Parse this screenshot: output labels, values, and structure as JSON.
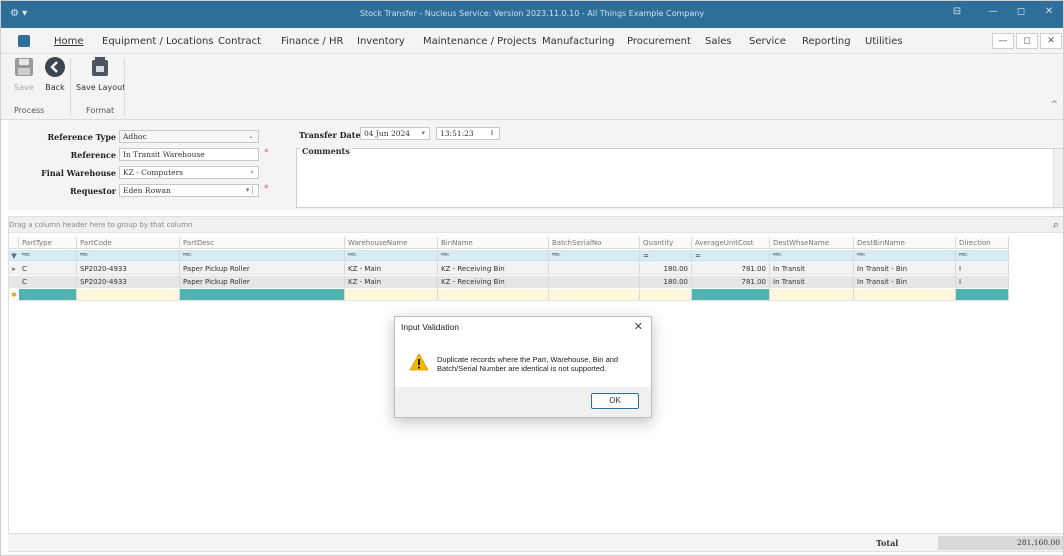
{
  "window": {
    "title": "Stock Transfer - Nucleus Service: Version 2023.11.0.10 - All Things Example Company",
    "left_glyph": "⚙ ▾",
    "controls": [
      "⊟",
      "—",
      "◻",
      "✕"
    ]
  },
  "menu": {
    "items": [
      "Home",
      "Equipment / Locations",
      "Contract",
      "Finance / HR",
      "Inventory",
      "Maintenance / Projects",
      "Manufacturing",
      "Procurement",
      "Sales",
      "Service",
      "Reporting",
      "Utilities"
    ],
    "window_controls": [
      "—",
      "◻",
      "✕"
    ]
  },
  "ribbon": {
    "save_label": "Save",
    "back_label": "Back",
    "save_layout_label": "Save Layout",
    "group_process": "Process",
    "group_format": "Format",
    "collapse_glyph": "^"
  },
  "form": {
    "reference_type_label": "Reference Type",
    "reference_type_value": "Adhoc",
    "reference_label": "Reference",
    "reference_value": "In Transit Warehouse",
    "final_warehouse_label": "Final Warehouse",
    "final_warehouse_value": "KZ - Computers",
    "requestor_label": "Requestor",
    "requestor_value": "Eden Rowan",
    "transfer_date_label": "Transfer Date",
    "transfer_date_value": "04 Jun 2024",
    "transfer_time_value": "13:51:23",
    "comments_label": "Comments",
    "required_mark": "*"
  },
  "grid": {
    "group_hint": "Drag a column header here to group by that column",
    "columns": [
      "PartType",
      "PartCode",
      "PartDesc",
      "WarehouseName",
      "BinName",
      "BatchSerialNo",
      "Quantity",
      "AverageUnitCost",
      "DestWhseName",
      "DestBinName",
      "Direction"
    ],
    "filter_row": [
      "ᴿᴮᶜ",
      "ᴿᴮᶜ",
      "ᴿᴮᶜ",
      "ᴿᴮᶜ",
      "ᴿᴮᶜ",
      "ᴿᴮᶜ",
      "=",
      "=",
      "ᴿᴮᶜ",
      "ᴿᴮᶜ",
      "ᴿᴮᶜ"
    ],
    "rows": [
      [
        "C",
        "SP2020-4933",
        "Paper Pickup Roller",
        "KZ - Main",
        "KZ - Receiving Bin",
        "",
        "180.00",
        "781.00",
        "In Transit",
        "In Transit - Bin",
        "I"
      ],
      [
        "C",
        "SP2020-4933",
        "Paper Pickup Roller",
        "KZ - Main",
        "KZ - Receiving Bin",
        "",
        "180.00",
        "781.00",
        "In Transit",
        "In Transit - Bin",
        "I"
      ]
    ],
    "row_indicator": "▸",
    "new_row_indicator": "✱",
    "filter_indicator": "▼"
  },
  "total": {
    "label": "Total",
    "value": "281,160.00"
  },
  "dialog": {
    "title": "Input Validation",
    "message": "Duplicate records where the Part, Warehouse, Bin and Batch/Serial Number are identical is not supported.",
    "ok_label": "OK",
    "close_glyph": "✕"
  },
  "colors": {
    "titlebar": "#2e6f9a",
    "filter_row": "#d6ebf2",
    "new_row_teal": "#4fb3b0",
    "required": "#d9534f",
    "warning": "#f5b800"
  }
}
